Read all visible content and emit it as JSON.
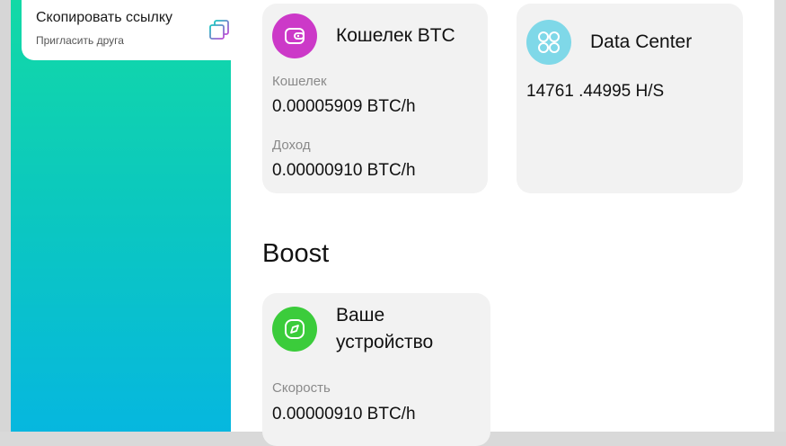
{
  "invite": {
    "title": "Скопировать ссылку",
    "subtitle": "Пригласить друга",
    "icon": "copy-icon"
  },
  "wallet_card": {
    "title": "Кошелек BTC",
    "icon": "wallet-icon",
    "icon_color": "#cc39c8",
    "wallet_label": "Кошелек",
    "wallet_value": "0.00005909 BTC/h",
    "income_label": "Доход",
    "income_value": "0.00000910 BTC/h"
  },
  "datacenter_card": {
    "title": "Data Center",
    "icon": "grid-dots-icon",
    "icon_color": "#7fd8e8",
    "value": "14761 .44995 H/S"
  },
  "boost": {
    "title": "Boost"
  },
  "device_card": {
    "title_line1": "Ваше",
    "title_line2": "устройство",
    "icon": "compass-icon",
    "icon_color": "#3bcc3b",
    "speed_label": "Скорость",
    "speed_value": "0.00000910 BTC/h"
  },
  "colors": {
    "gradient_top": "#12d9a6",
    "gradient_bottom": "#06b7df",
    "card_bg": "#f2f2f2"
  }
}
